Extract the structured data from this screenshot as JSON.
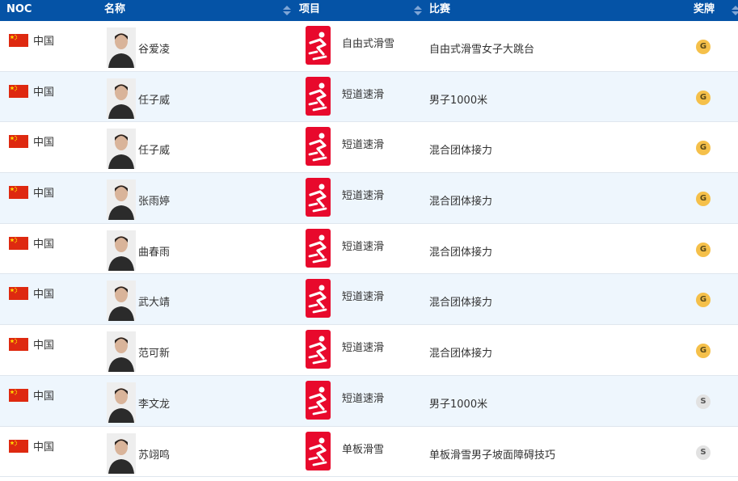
{
  "header": {
    "noc": "NOC",
    "name": "名称",
    "sport": "项目",
    "event": "比赛",
    "medal": "奖牌"
  },
  "colors": {
    "header_bg": "#0553a6",
    "row_alt_bg": "#eef6fd",
    "pictogram_red": "#e8092c",
    "gold": "#f5c04a",
    "silver": "#e2e2e2"
  },
  "rows": [
    {
      "noc": "中国",
      "flag_icon": "china-flag-icon",
      "name": "谷爱凌",
      "sport": "自由式滑雪",
      "sport_icon": "freestyle-skiing-icon",
      "event": "自由式滑雪女子大跳台",
      "medal": "G",
      "medal_type": "gold"
    },
    {
      "noc": "中国",
      "flag_icon": "china-flag-icon",
      "name": "任子威",
      "sport": "短道速滑",
      "sport_icon": "short-track-icon",
      "event": "男子1000米",
      "medal": "G",
      "medal_type": "gold"
    },
    {
      "noc": "中国",
      "flag_icon": "china-flag-icon",
      "name": "任子威",
      "sport": "短道速滑",
      "sport_icon": "short-track-icon",
      "event": "混合团体接力",
      "medal": "G",
      "medal_type": "gold"
    },
    {
      "noc": "中国",
      "flag_icon": "china-flag-icon",
      "name": "张雨婷",
      "sport": "短道速滑",
      "sport_icon": "short-track-icon",
      "event": "混合团体接力",
      "medal": "G",
      "medal_type": "gold"
    },
    {
      "noc": "中国",
      "flag_icon": "china-flag-icon",
      "name": "曲春雨",
      "sport": "短道速滑",
      "sport_icon": "short-track-icon",
      "event": "混合团体接力",
      "medal": "G",
      "medal_type": "gold"
    },
    {
      "noc": "中国",
      "flag_icon": "china-flag-icon",
      "name": "武大靖",
      "sport": "短道速滑",
      "sport_icon": "short-track-icon",
      "event": "混合团体接力",
      "medal": "G",
      "medal_type": "gold"
    },
    {
      "noc": "中国",
      "flag_icon": "china-flag-icon",
      "name": "范可新",
      "sport": "短道速滑",
      "sport_icon": "short-track-icon",
      "event": "混合团体接力",
      "medal": "G",
      "medal_type": "gold"
    },
    {
      "noc": "中国",
      "flag_icon": "china-flag-icon",
      "name": "李文龙",
      "sport": "短道速滑",
      "sport_icon": "short-track-icon",
      "event": "男子1000米",
      "medal": "S",
      "medal_type": "silver"
    },
    {
      "noc": "中国",
      "flag_icon": "china-flag-icon",
      "name": "苏翊鸣",
      "sport": "单板滑雪",
      "sport_icon": "snowboard-icon",
      "event": "单板滑雪男子坡面障碍技巧",
      "medal": "S",
      "medal_type": "silver"
    }
  ]
}
